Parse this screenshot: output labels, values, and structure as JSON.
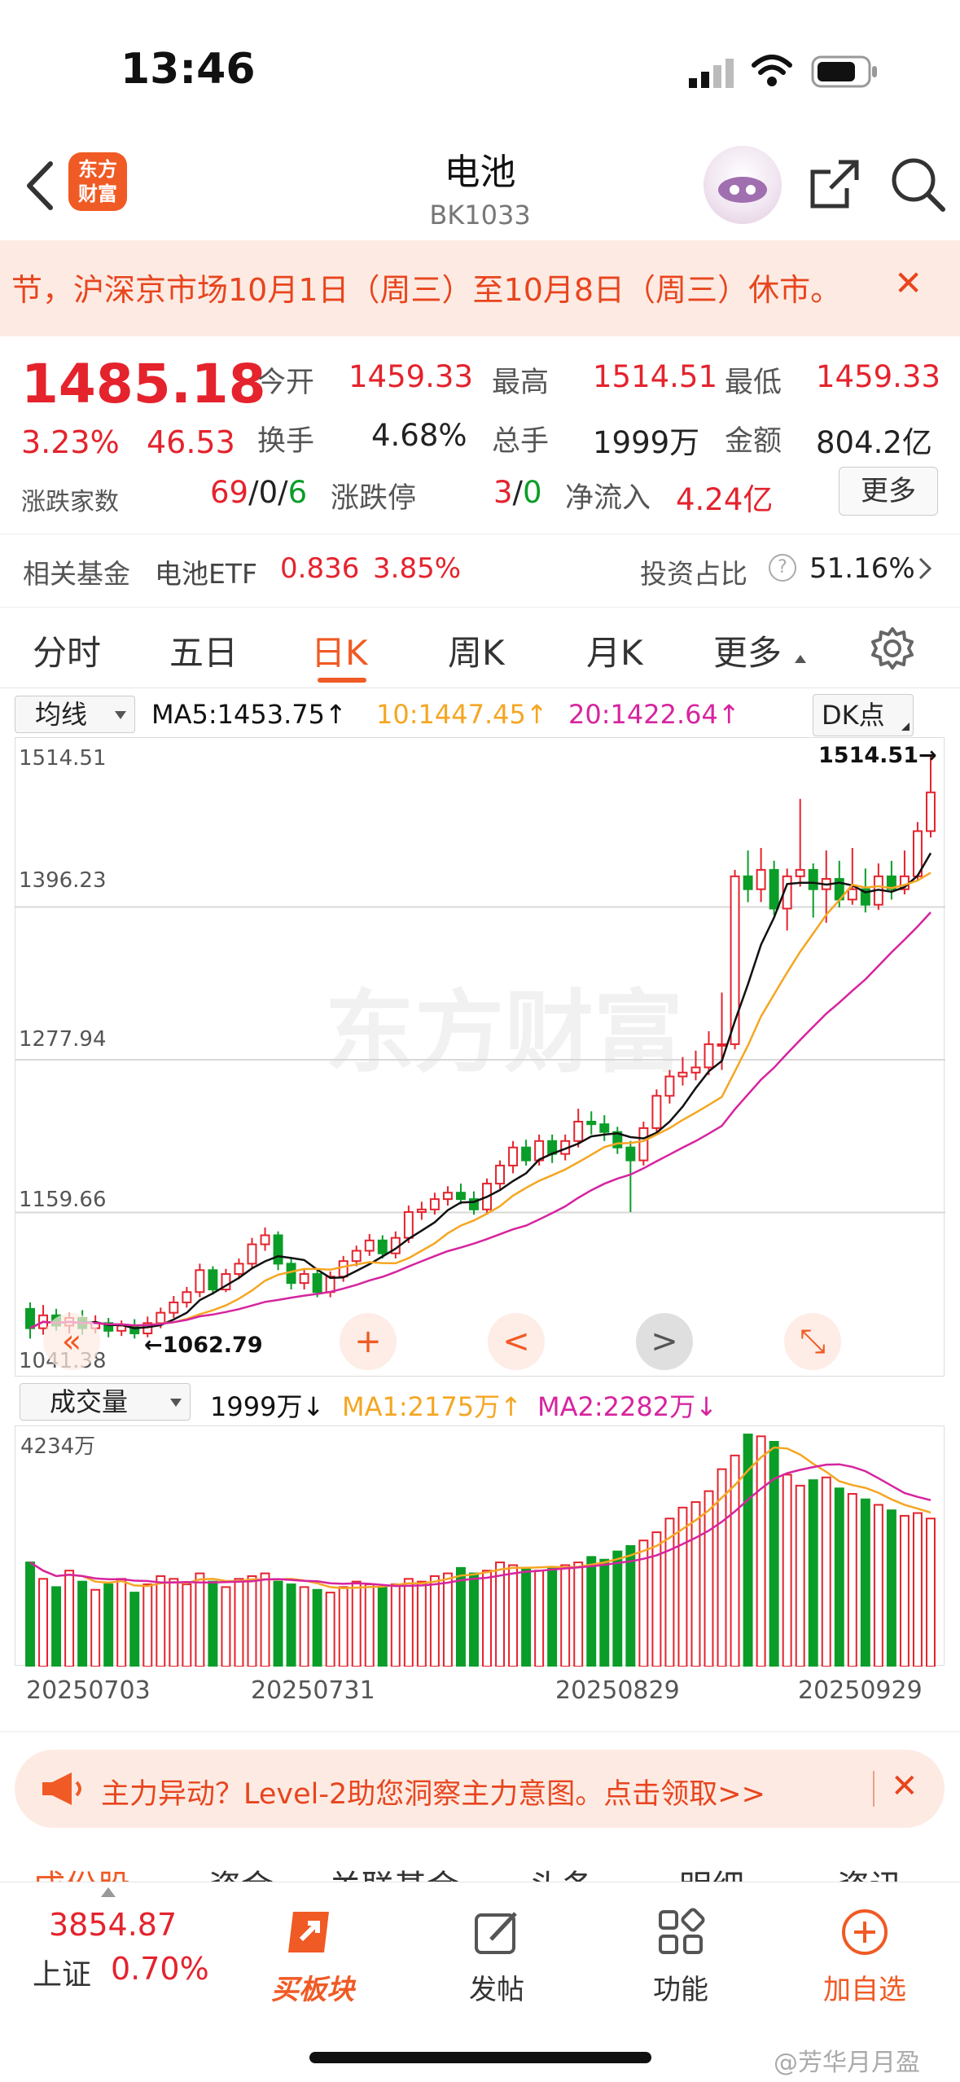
{
  "status_bar": {
    "time": "13:46"
  },
  "header": {
    "title": "电池",
    "code": "BK1033",
    "logo_line1": "东方",
    "logo_line2": "财富"
  },
  "notice": {
    "text": "节，沪深京市场10月1日（周三）至10月8日（周三）休市。",
    "close": "✕"
  },
  "quote": {
    "price": "1485.18",
    "change_pct": "3.23%",
    "change": "46.53",
    "open_label": "今开",
    "open": "1459.33",
    "high_label": "最高",
    "high": "1514.51",
    "low_label": "最低",
    "low": "1459.33",
    "turnover_label": "换手",
    "turnover": "4.68%",
    "volume_label": "总手",
    "volume": "1999万",
    "amount_label": "金额",
    "amount": "804.2亿",
    "breadth_label": "涨跌家数",
    "breadth_up": "69",
    "breadth_flat": "0",
    "breadth_down": "6",
    "limit_label": "涨跌停",
    "limit_up": "3",
    "limit_down": "0",
    "inflow_label": "净流入",
    "inflow": "4.24亿",
    "more_button": "更多"
  },
  "fund": {
    "label": "相关基金",
    "name": "电池ETF",
    "price": "0.836",
    "pct": "3.85%",
    "ratio_label": "投资占比",
    "ratio": "51.16%"
  },
  "tabs": [
    {
      "label": "分时"
    },
    {
      "label": "五日"
    },
    {
      "label": "日K"
    },
    {
      "label": "周K"
    },
    {
      "label": "月K"
    },
    {
      "label": "更多"
    }
  ],
  "indicator": {
    "select": "均线",
    "ma5": "MA5:1453.75↑",
    "ma10": "10:1447.45↑",
    "ma20": "20:1422.64↑",
    "dk": "DK点",
    "vol_select": "成交量",
    "vol_now": "1999万↓",
    "vol_ma1": "MA1:2175万↑",
    "vol_ma2": "MA2:2282万↓"
  },
  "colors": {
    "up": "#e4232d",
    "down": "#0a9d28",
    "ma5": "#111111",
    "ma10": "#f5a623",
    "ma20": "#d6249f",
    "accent": "#f05a24"
  },
  "chart_data": {
    "type": "candlestick",
    "y_ticks": [
      "1514.51",
      "1396.23",
      "1277.94",
      "1159.66",
      "1041.38"
    ],
    "ylim": [
      1041.38,
      1514.51
    ],
    "max_label": "1514.51→",
    "min_label": "←1062.79",
    "x_labels": [
      "20250703",
      "20250731",
      "20250829",
      "20250929"
    ],
    "vol_max_label": "4234万",
    "watermark": "东方财富",
    "candles": [
      [
        1085,
        1070,
        1090,
        1062
      ],
      [
        1070,
        1080,
        1088,
        1065
      ],
      [
        1080,
        1072,
        1085,
        1068
      ],
      [
        1072,
        1078,
        1082,
        1066
      ],
      [
        1078,
        1070,
        1084,
        1065
      ],
      [
        1070,
        1074,
        1080,
        1066
      ],
      [
        1074,
        1068,
        1078,
        1063
      ],
      [
        1068,
        1072,
        1076,
        1064
      ],
      [
        1072,
        1066,
        1077,
        1062
      ],
      [
        1066,
        1074,
        1079,
        1063
      ],
      [
        1074,
        1082,
        1086,
        1070
      ],
      [
        1082,
        1090,
        1095,
        1078
      ],
      [
        1090,
        1098,
        1102,
        1086
      ],
      [
        1098,
        1115,
        1120,
        1094
      ],
      [
        1115,
        1100,
        1118,
        1096
      ],
      [
        1100,
        1112,
        1116,
        1098
      ],
      [
        1112,
        1120,
        1124,
        1108
      ],
      [
        1120,
        1135,
        1140,
        1116
      ],
      [
        1135,
        1142,
        1148,
        1130
      ],
      [
        1142,
        1120,
        1145,
        1115
      ],
      [
        1120,
        1105,
        1124,
        1100
      ],
      [
        1105,
        1112,
        1116,
        1100
      ],
      [
        1112,
        1098,
        1115,
        1094
      ],
      [
        1098,
        1110,
        1114,
        1094
      ],
      [
        1110,
        1122,
        1126,
        1106
      ],
      [
        1122,
        1130,
        1134,
        1118
      ],
      [
        1130,
        1138,
        1143,
        1126
      ],
      [
        1138,
        1128,
        1142,
        1124
      ],
      [
        1128,
        1140,
        1145,
        1124
      ],
      [
        1140,
        1160,
        1165,
        1136
      ],
      [
        1160,
        1162,
        1168,
        1154
      ],
      [
        1162,
        1170,
        1175,
        1158
      ],
      [
        1170,
        1175,
        1180,
        1165
      ],
      [
        1175,
        1170,
        1182,
        1166
      ],
      [
        1170,
        1162,
        1176,
        1158
      ],
      [
        1162,
        1182,
        1186,
        1158
      ],
      [
        1182,
        1196,
        1200,
        1178
      ],
      [
        1196,
        1210,
        1215,
        1190
      ],
      [
        1210,
        1200,
        1216,
        1196
      ],
      [
        1200,
        1215,
        1220,
        1196
      ],
      [
        1215,
        1205,
        1220,
        1198
      ],
      [
        1205,
        1215,
        1220,
        1200
      ],
      [
        1215,
        1230,
        1240,
        1210
      ],
      [
        1230,
        1228,
        1238,
        1220
      ],
      [
        1228,
        1222,
        1235,
        1215
      ],
      [
        1222,
        1210,
        1226,
        1205
      ],
      [
        1210,
        1200,
        1215,
        1160
      ],
      [
        1200,
        1225,
        1230,
        1196
      ],
      [
        1225,
        1250,
        1255,
        1220
      ],
      [
        1250,
        1265,
        1270,
        1244
      ],
      [
        1265,
        1268,
        1280,
        1258
      ],
      [
        1268,
        1272,
        1285,
        1262
      ],
      [
        1272,
        1290,
        1300,
        1266
      ],
      [
        1290,
        1290,
        1330,
        1270
      ],
      [
        1290,
        1420,
        1425,
        1286
      ],
      [
        1420,
        1410,
        1440,
        1400
      ],
      [
        1410,
        1425,
        1442,
        1400
      ],
      [
        1425,
        1395,
        1432,
        1390
      ],
      [
        1395,
        1420,
        1426,
        1378
      ],
      [
        1420,
        1425,
        1480,
        1412
      ],
      [
        1425,
        1410,
        1430,
        1388
      ],
      [
        1410,
        1418,
        1440,
        1384
      ],
      [
        1418,
        1402,
        1432,
        1396
      ],
      [
        1402,
        1410,
        1442,
        1398
      ],
      [
        1410,
        1398,
        1426,
        1392
      ],
      [
        1398,
        1420,
        1430,
        1394
      ],
      [
        1420,
        1410,
        1432,
        1402
      ],
      [
        1410,
        1420,
        1440,
        1406
      ],
      [
        1420,
        1455,
        1462,
        1416
      ],
      [
        1455,
        1485,
        1514,
        1450
      ]
    ],
    "volumes": [
      1900,
      1600,
      1450,
      1750,
      1550,
      1400,
      1500,
      1600,
      1350,
      1500,
      1650,
      1600,
      1500,
      1700,
      1550,
      1450,
      1600,
      1650,
      1700,
      1550,
      1500,
      1450,
      1400,
      1350,
      1450,
      1550,
      1500,
      1450,
      1500,
      1600,
      1550,
      1650,
      1700,
      1800,
      1700,
      1750,
      1900,
      1850,
      1800,
      1750,
      1800,
      1850,
      1900,
      2000,
      1950,
      2100,
      2200,
      2300,
      2450,
      2700,
      2900,
      3000,
      3200,
      3600,
      3850,
      4234,
      4200,
      4100,
      3500,
      3300,
      3400,
      3450,
      3250,
      3150,
      3050,
      2950,
      2850,
      2750,
      2800,
      2700
    ],
    "ma_lines": [
      "ma5",
      "ma10",
      "ma20"
    ]
  },
  "chart_controls": {
    "left": "«",
    "zoom_in": "+",
    "prev": "<",
    "next": ">",
    "fullscreen": "⤡"
  },
  "promo": {
    "text": "主力异动？Level-2助您洞察主力意图。点击领取>>",
    "close": "✕"
  },
  "subtabs": [
    "成份股",
    "资金",
    "关联基金",
    "头条",
    "明细",
    "资讯"
  ],
  "bottom_nav": {
    "index_value": "3854.87",
    "index_name": "上证",
    "index_pct": "0.70%",
    "items": [
      {
        "label": "买板块"
      },
      {
        "label": "发帖"
      },
      {
        "label": "功能"
      },
      {
        "label": "加自选"
      }
    ]
  },
  "watermark_corner": "@芳华月月盈"
}
